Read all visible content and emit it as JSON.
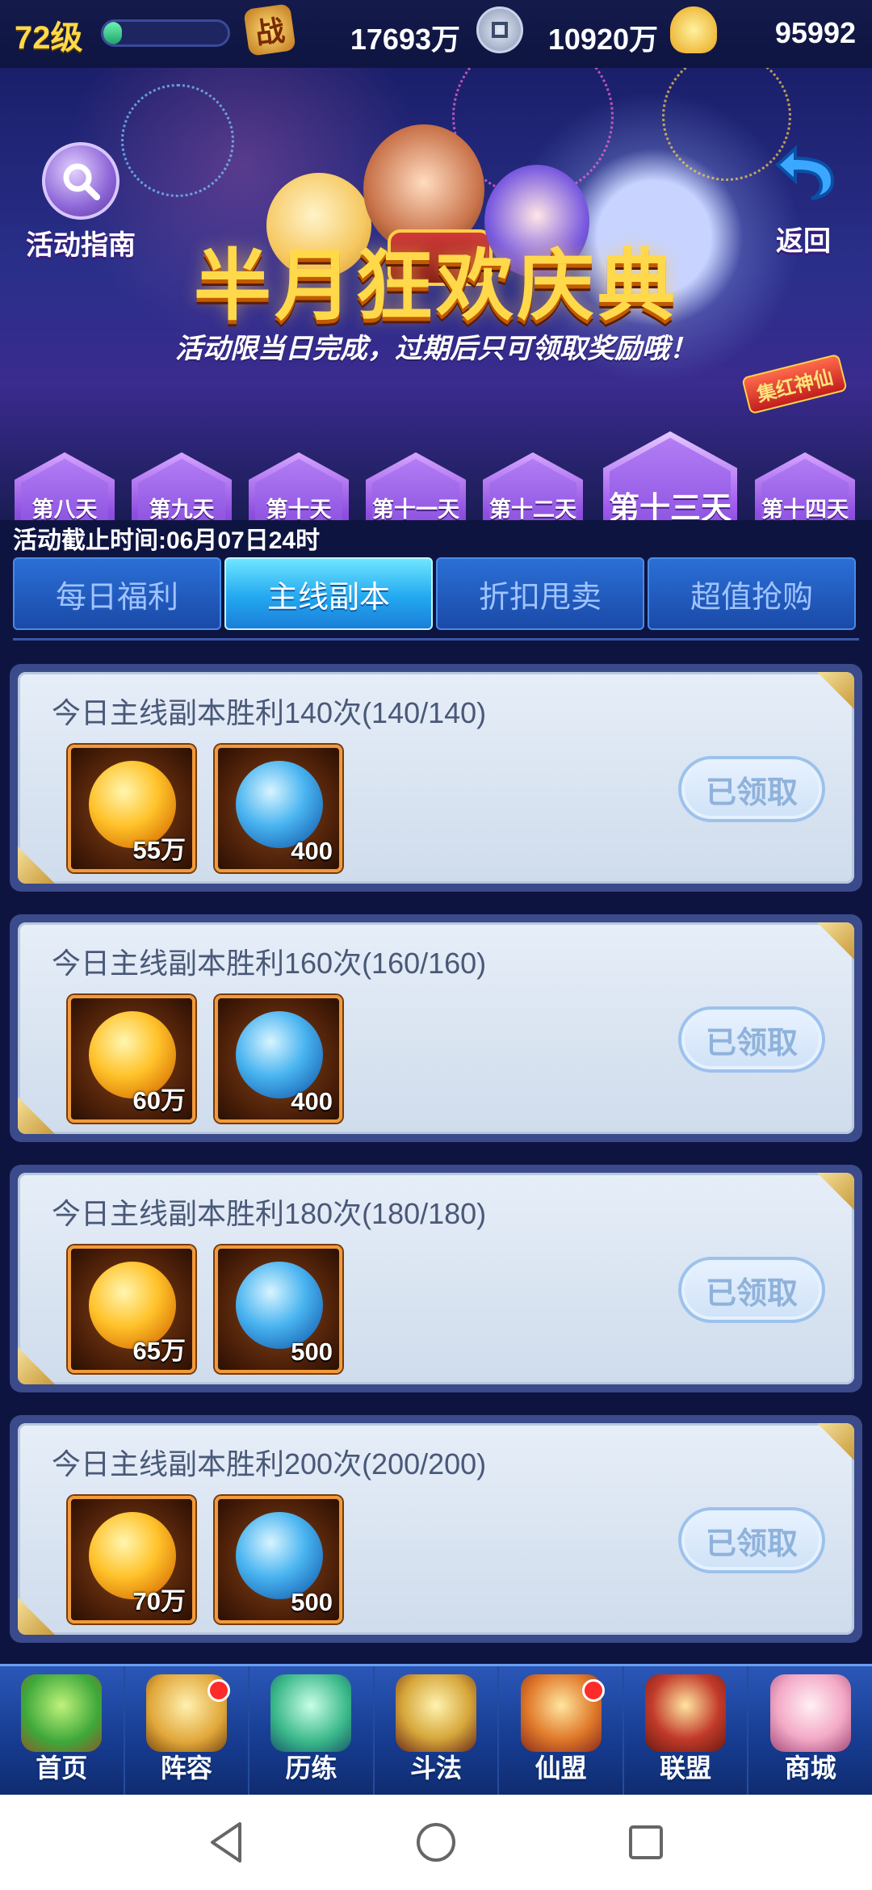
{
  "status": {
    "level": "72级",
    "level_progress": 0.15,
    "power_icon_text": "战",
    "power": "17693万",
    "coins": "10920万",
    "gold": "95992"
  },
  "banner": {
    "guide_label": "活动指南",
    "back_label": "返回",
    "title": "半月狂欢庆典",
    "subtitle": "活动限当日完成，过期后只可领取奖励哦！"
  },
  "days": [
    {
      "label": "第八天"
    },
    {
      "label": "第九天"
    },
    {
      "label": "第十天"
    },
    {
      "label": "第十一天"
    },
    {
      "label": "第十二天"
    },
    {
      "label": "第十三天",
      "active": true
    },
    {
      "label": "第十四天"
    }
  ],
  "day_badge": "集红神仙",
  "deadline": "活动截止时间:06月07日24时",
  "tabs": [
    {
      "label": "每日福利"
    },
    {
      "label": "主线副本",
      "active": true
    },
    {
      "label": "折扣甩卖"
    },
    {
      "label": "超值抢购"
    }
  ],
  "tasks": [
    {
      "title": "今日主线副本胜利140次(140/140)",
      "reward1": "55万",
      "reward2": "400",
      "status": "已领取"
    },
    {
      "title": "今日主线副本胜利160次(160/160)",
      "reward1": "60万",
      "reward2": "400",
      "status": "已领取"
    },
    {
      "title": "今日主线副本胜利180次(180/180)",
      "reward1": "65万",
      "reward2": "500",
      "status": "已领取"
    },
    {
      "title": "今日主线副本胜利200次(200/200)",
      "reward1": "70万",
      "reward2": "500",
      "status": "已领取"
    }
  ],
  "nav": [
    {
      "label": "首页",
      "icon": "island-icon"
    },
    {
      "label": "阵容",
      "icon": "formation-icon",
      "dot": true
    },
    {
      "label": "历练",
      "icon": "gourd-icon"
    },
    {
      "label": "斗法",
      "icon": "sword-icon"
    },
    {
      "label": "仙盟",
      "icon": "palace-icon",
      "dot": true
    },
    {
      "label": "联盟",
      "icon": "alliance-banner-icon"
    },
    {
      "label": "商城",
      "icon": "shop-girl-icon"
    }
  ]
}
